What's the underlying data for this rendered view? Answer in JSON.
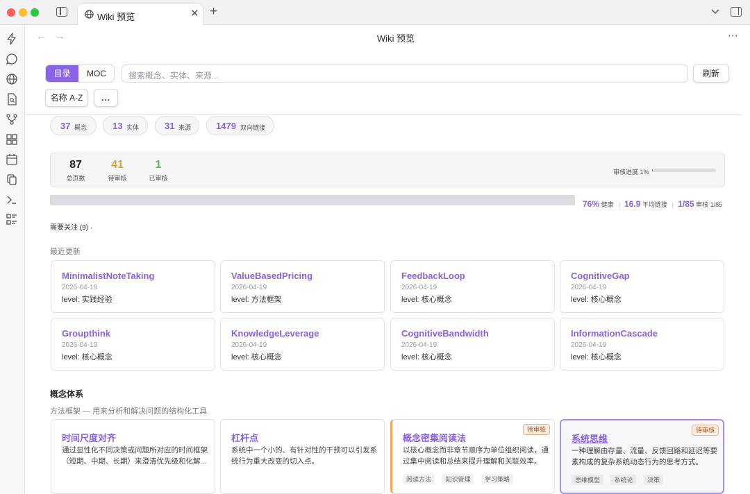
{
  "window": {
    "tab_title": "Wiki 预览",
    "tab_close": "✕",
    "tab_new": "+"
  },
  "header": {
    "title": "Wiki 预览",
    "back": "←",
    "forward": "→",
    "more": "⋯"
  },
  "toolbar": {
    "toc_label": "目录",
    "moc_label": "MOC",
    "search_placeholder": "搜索概念、实体、来源...",
    "refresh_label": "刷新",
    "sort_label": "名称 A-Z",
    "more_label": "..."
  },
  "stats": [
    {
      "value": "37",
      "label": "概念"
    },
    {
      "value": "13",
      "label": "实体"
    },
    {
      "value": "31",
      "label": "来源"
    },
    {
      "value": "1479",
      "label": "双向链接"
    }
  ],
  "review": {
    "total_pages": "87",
    "total_pages_label": "总页数",
    "pending": "41",
    "pending_label": "待审核",
    "reviewed": "1",
    "reviewed_label": "已审核",
    "progress_label": "审核进度 1%",
    "progress_fraction": 0.01,
    "colors": {
      "total": "#222222",
      "pending": "#d9a53a",
      "reviewed": "#4fbf4f"
    }
  },
  "health": {
    "health_value": "76%",
    "health_label": "健康",
    "avg_links_value": "16.9",
    "avg_links_label": "平均链接",
    "review_value": "1/85",
    "review_label": "审核 1/85",
    "separator": "|",
    "bar_fraction": 0.76
  },
  "attention": {
    "label": "需要关注 (9) ·"
  },
  "recent": {
    "label": "最近更新",
    "items": [
      {
        "title": "MinimalistNoteTaking",
        "date": "2026-04-19",
        "level": "level: 实践经验"
      },
      {
        "title": "ValueBasedPricing",
        "date": "2026-04-19",
        "level": "level: 方法框架"
      },
      {
        "title": "FeedbackLoop",
        "date": "2026-04-19",
        "level": "level: 核心概念"
      },
      {
        "title": "CognitiveGap",
        "date": "2026-04-19",
        "level": "level: 核心概念"
      },
      {
        "title": "Groupthink",
        "date": "2026-04-19",
        "level": "level: 核心概念"
      },
      {
        "title": "KnowledgeLeverage",
        "date": "2026-04-19",
        "level": "level: 核心概念"
      },
      {
        "title": "CognitiveBandwidth",
        "date": "2026-04-19",
        "level": "level: 核心概念"
      },
      {
        "title": "InformationCascade",
        "date": "2026-04-19",
        "level": "level: 核心概念"
      }
    ]
  },
  "concepts": {
    "heading": "概念体系",
    "subheading": "方法框架 — 用来分析和解决问题的结构化工具",
    "badge_label": "待审核",
    "items": [
      {
        "title": "时间尺度对齐",
        "desc": "通过显性化不同决策或问题所对应的时间框架（短期、中期、长期）来澄清优先级和化解...",
        "tags": []
      },
      {
        "title": "杠杆点",
        "desc": "系统中一个小的、有针对性的干预可以引发系统行为重大改变的切入点。",
        "tags": []
      },
      {
        "title": "概念密集阅读法",
        "desc": "以核心概念而非章节顺序为单位组织阅读，通过集中阅读和总结来提升理解和关联效率。",
        "tags": [
          "阅读方法",
          "知识管理",
          "学习策略"
        ]
      },
      {
        "title": "系统思维",
        "desc": "一种理解由存量、流量、反馈回路和延迟等要素构成的复杂系统动态行为的思考方式。",
        "tags": [
          "思维模型",
          "系统论",
          "决策"
        ]
      }
    ]
  },
  "colors": {
    "accent": "#8763dd",
    "toc_active": "#8a63e6",
    "badge_bg": "#fdeee3",
    "badge_text": "#b0561f",
    "orange_accent": "#f0a65f"
  },
  "icons": {
    "ribbon": [
      "lightning-icon",
      "chat-icon",
      "globe-icon",
      "file-search-icon",
      "graph-icon",
      "grid-icon",
      "calendar-icon",
      "copy-icon",
      "terminal-icon",
      "list-icon"
    ]
  }
}
